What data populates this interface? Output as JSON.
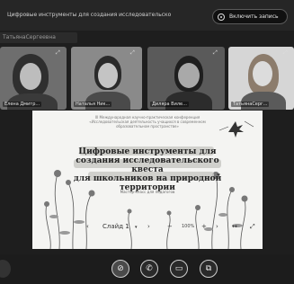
{
  "header": {
    "title": "Цифровые инструменты для создания исследовательско",
    "record_label": "Включить запись"
  },
  "self_name": "ТатьянаСергеевна",
  "participants": [
    {
      "name": "Елена Дмитр..."
    },
    {
      "name": "Наталья Ник..."
    },
    {
      "name": "Диляра Виле..."
    },
    {
      "name": "ТатьянаСерг..."
    }
  ],
  "slide": {
    "header_lines": [
      "III Международная научно-практическая конференция",
      "«Исследовательская деятельность учащихся в современном",
      "образовательном пространстве»"
    ],
    "title_lines": [
      "Цифровые инструменты для",
      "создания исследовательского квеста",
      "для школьников на природной",
      "территории"
    ],
    "subtitle": "Мастер-класс для педагогов"
  },
  "presentation_controls": {
    "slide_counter": "Слайд 1",
    "zoom": "100%"
  },
  "icons": [
    "record-icon",
    "expand-icon",
    "chevron-left-icon",
    "chevron-right-icon",
    "chevron-down-icon",
    "zoom-out-icon",
    "zoom-in-icon",
    "fullscreen-icon",
    "microphone-off-icon",
    "phone-icon",
    "camera-icon",
    "screen-share-icon"
  ]
}
